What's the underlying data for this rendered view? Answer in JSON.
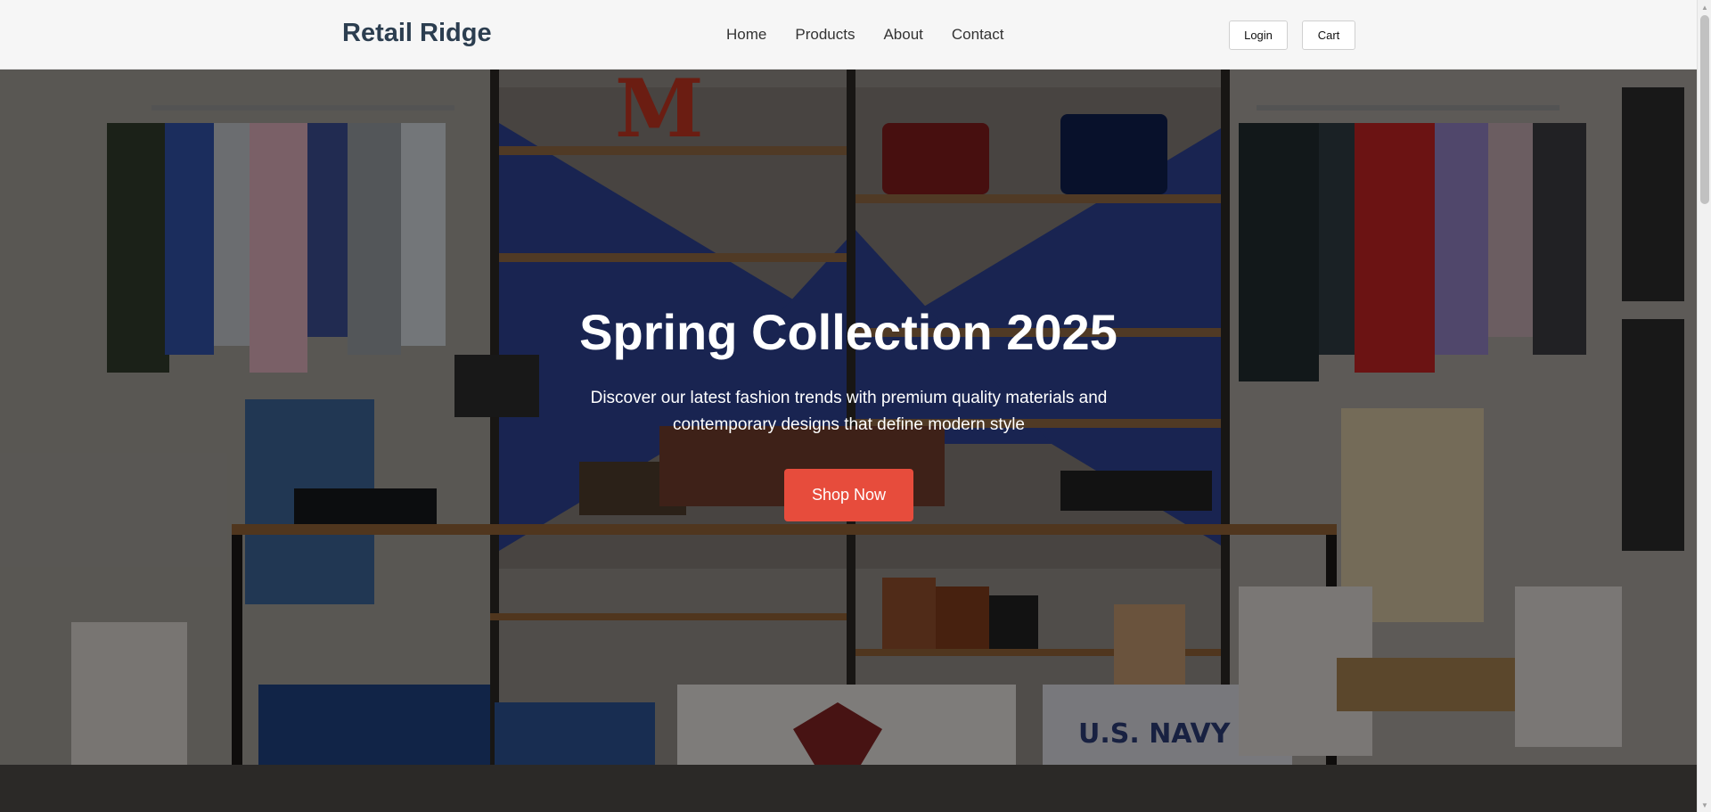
{
  "header": {
    "logo": "Retail Ridge",
    "nav": [
      "Home",
      "Products",
      "About",
      "Contact"
    ],
    "login_label": "Login",
    "cart_label": "Cart"
  },
  "hero": {
    "title": "Spring Collection 2025",
    "subtitle": "Discover our latest fashion trends with premium quality materials and contemporary designs that define modern style",
    "cta_label": "Shop Now"
  },
  "colors": {
    "logo": "#2c3e50",
    "accent": "#e74c3c"
  }
}
